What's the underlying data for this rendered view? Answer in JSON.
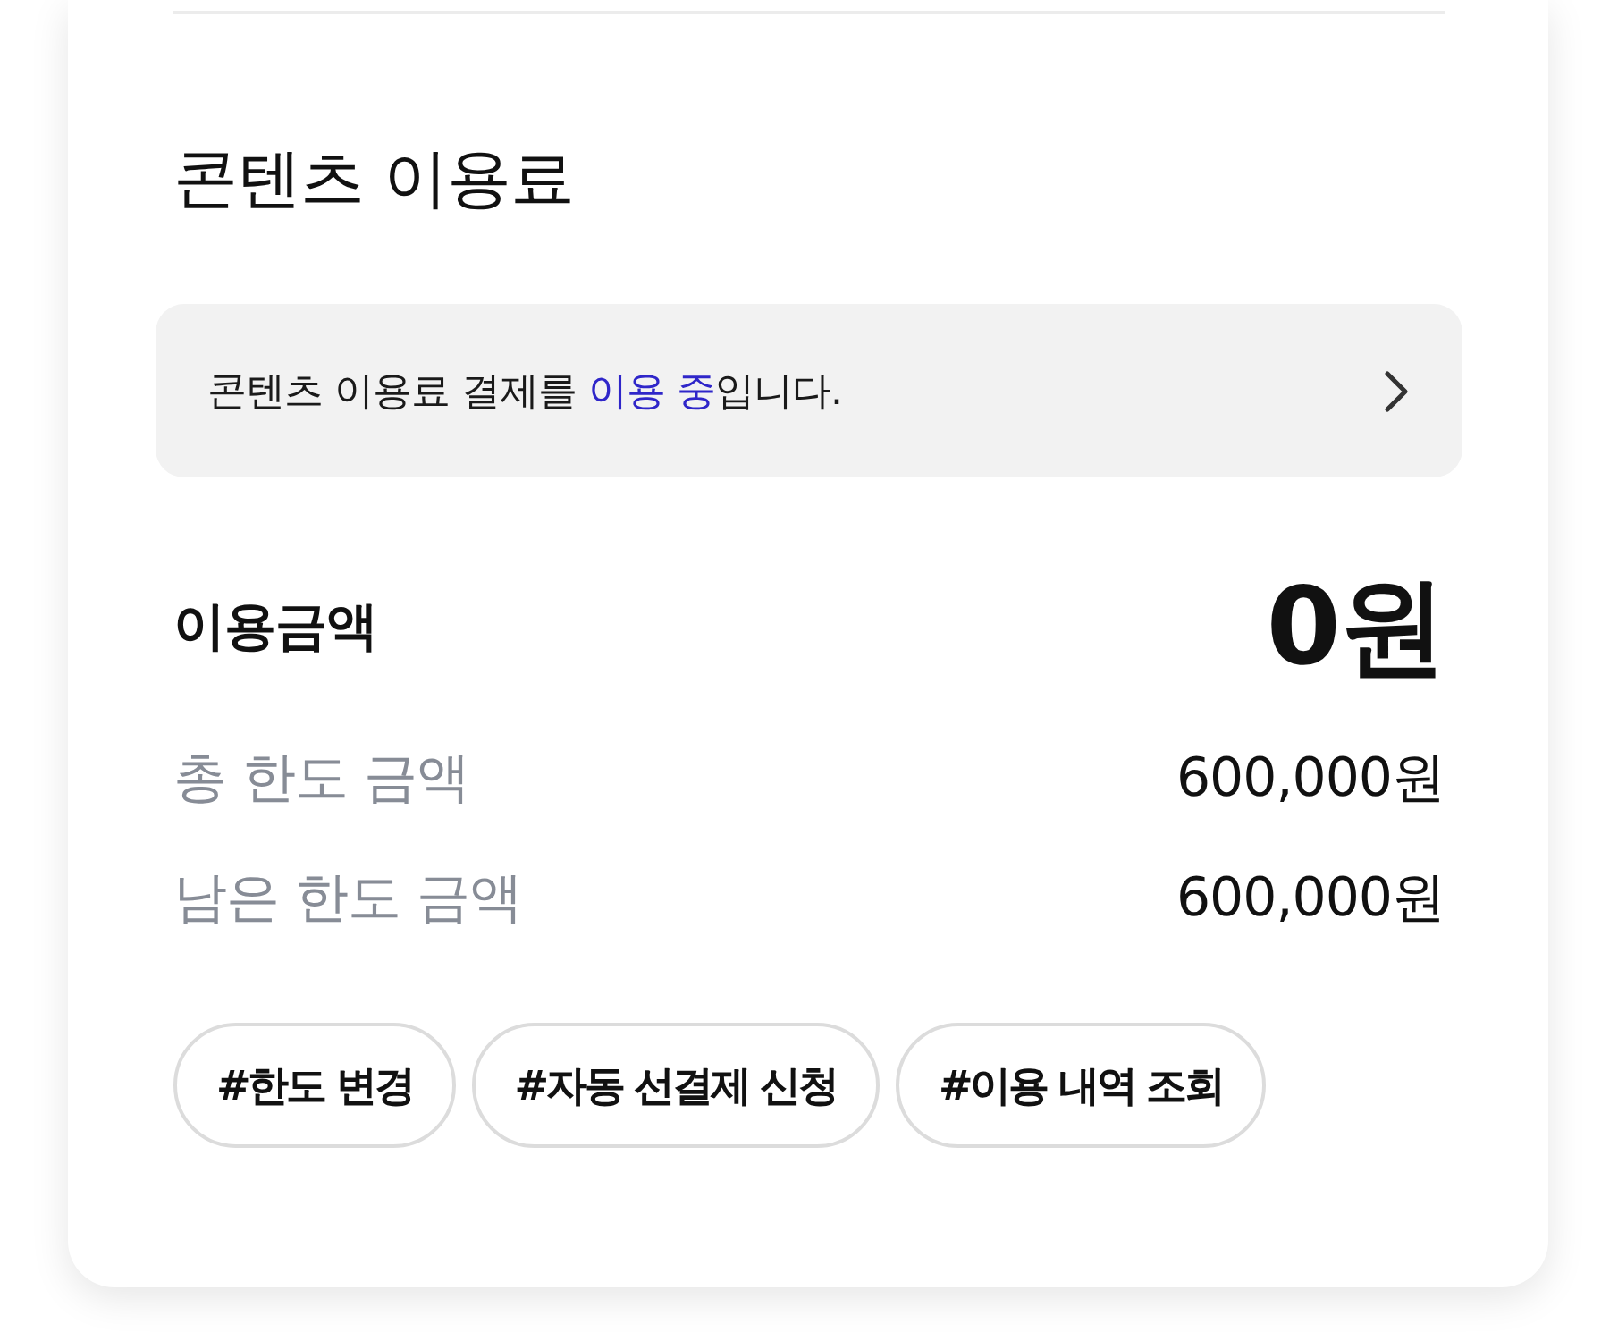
{
  "section": {
    "title": "콘텐츠 이용료"
  },
  "notice": {
    "parts": [
      {
        "text": "콘텐츠 이용료 결제를 ",
        "highlight": false
      },
      {
        "text": "이용 중",
        "highlight": true
      },
      {
        "text": "입니다.",
        "highlight": false
      }
    ]
  },
  "usage": {
    "label": "이용금액",
    "amount": "0원"
  },
  "limits": [
    {
      "label": "총 한도 금액",
      "value": "600,000원"
    },
    {
      "label": "남은 한도 금액",
      "value": "600,000원"
    }
  ],
  "tags": [
    "#한도 변경",
    "#자동 선결제 신청",
    "#이용 내역 조회"
  ]
}
